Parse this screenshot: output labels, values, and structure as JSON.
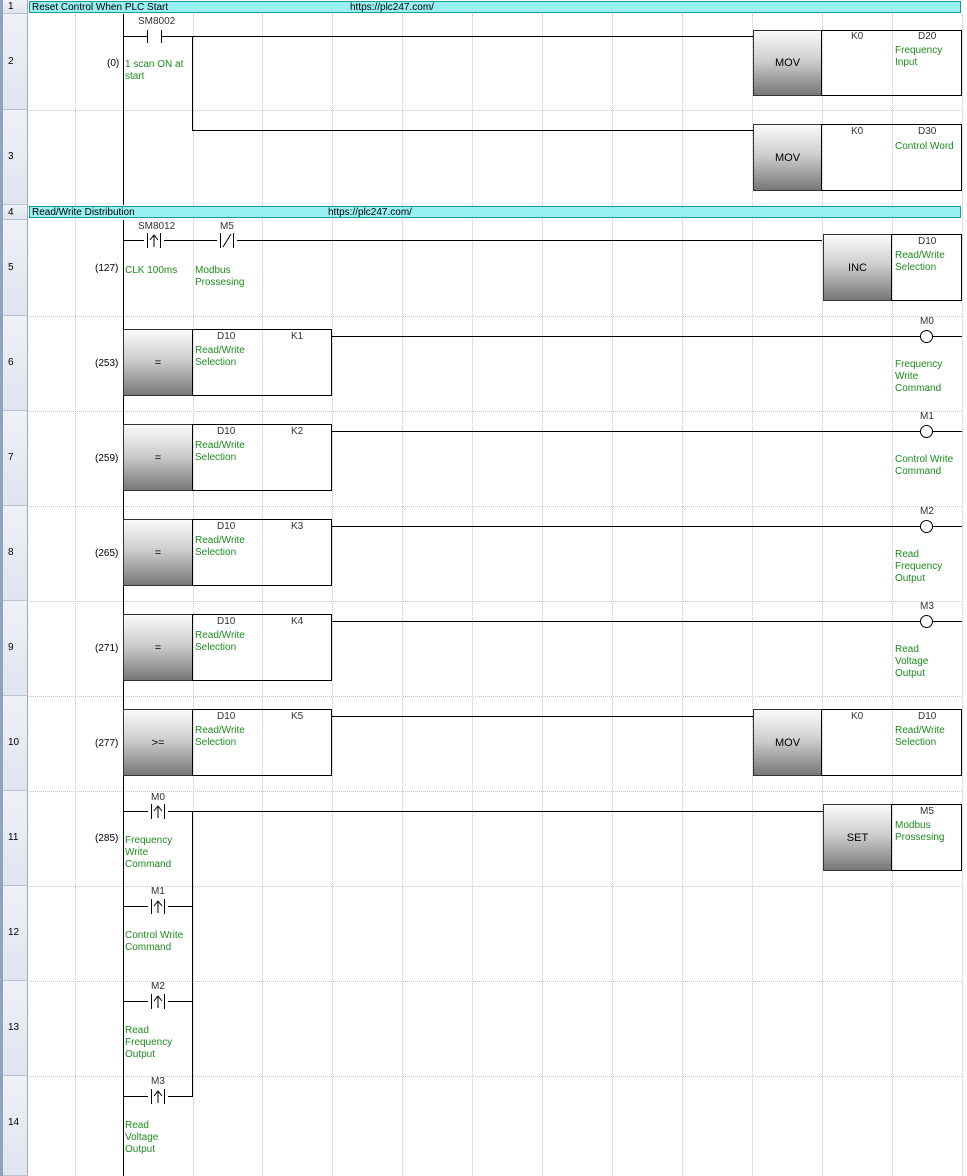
{
  "comments": [
    {
      "row": "1",
      "text": "Reset Control When PLC Start",
      "url": "https://plc247.com/"
    },
    {
      "row": "4",
      "text": "Read/Write Distribution",
      "url": "https://plc247.com/"
    }
  ],
  "rows": [
    "1",
    "2",
    "3",
    "4",
    "5",
    "6",
    "7",
    "8",
    "9",
    "10",
    "11",
    "12",
    "13",
    "14"
  ],
  "rung2": {
    "step": "(0)",
    "contact": {
      "device": "SM8002",
      "comment": "1 scan ON at\nstart"
    },
    "instr": "MOV",
    "src": "K0",
    "dst": "D20",
    "dst_comment": "Frequency\nInput"
  },
  "rung3": {
    "instr": "MOV",
    "src": "K0",
    "dst": "D30",
    "dst_comment": "Control Word"
  },
  "rung5": {
    "step": "(127)",
    "contact1": {
      "device": "SM8012",
      "comment": "CLK 100ms"
    },
    "contact2": {
      "device": "M5",
      "comment": "Modbus\nProssesing"
    },
    "instr": "INC",
    "dst": "D10",
    "dst_comment": "Read/Write\nSelection"
  },
  "compares": [
    {
      "row": "6",
      "step": "(253)",
      "op": "=",
      "dev": "D10",
      "dev_comment": "Read/Write\nSelection",
      "k": "K1",
      "coil": "M0",
      "coil_comment": "Frequency\nWrite\nCommand"
    },
    {
      "row": "7",
      "step": "(259)",
      "op": "=",
      "dev": "D10",
      "dev_comment": "Read/Write\nSelection",
      "k": "K2",
      "coil": "M1",
      "coil_comment": "Control Write\nCommand"
    },
    {
      "row": "8",
      "step": "(265)",
      "op": "=",
      "dev": "D10",
      "dev_comment": "Read/Write\nSelection",
      "k": "K3",
      "coil": "M2",
      "coil_comment": "Read\nFrequency\nOutput"
    },
    {
      "row": "9",
      "step": "(271)",
      "op": "=",
      "dev": "D10",
      "dev_comment": "Read/Write\nSelection",
      "k": "K4",
      "coil": "M3",
      "coil_comment": "Read\nVoltage\nOutput"
    }
  ],
  "rung10": {
    "step": "(277)",
    "op": ">=",
    "dev": "D10",
    "dev_comment": "Read/Write\nSelection",
    "k": "K5",
    "instr": "MOV",
    "src": "K0",
    "dst": "D10",
    "dst_comment": "Read/Write\nSelection"
  },
  "rung11": {
    "step": "(285)",
    "contacts": [
      {
        "device": "M0",
        "comment": "Frequency\nWrite\nCommand"
      },
      {
        "device": "M1",
        "comment": "Control Write\nCommand"
      },
      {
        "device": "M2",
        "comment": "Read\nFrequency\nOutput"
      },
      {
        "device": "M3",
        "comment": "Read\nVoltage\nOutput"
      }
    ],
    "instr": "SET",
    "dst": "M5",
    "dst_comment": "Modbus\nProssesing"
  }
}
